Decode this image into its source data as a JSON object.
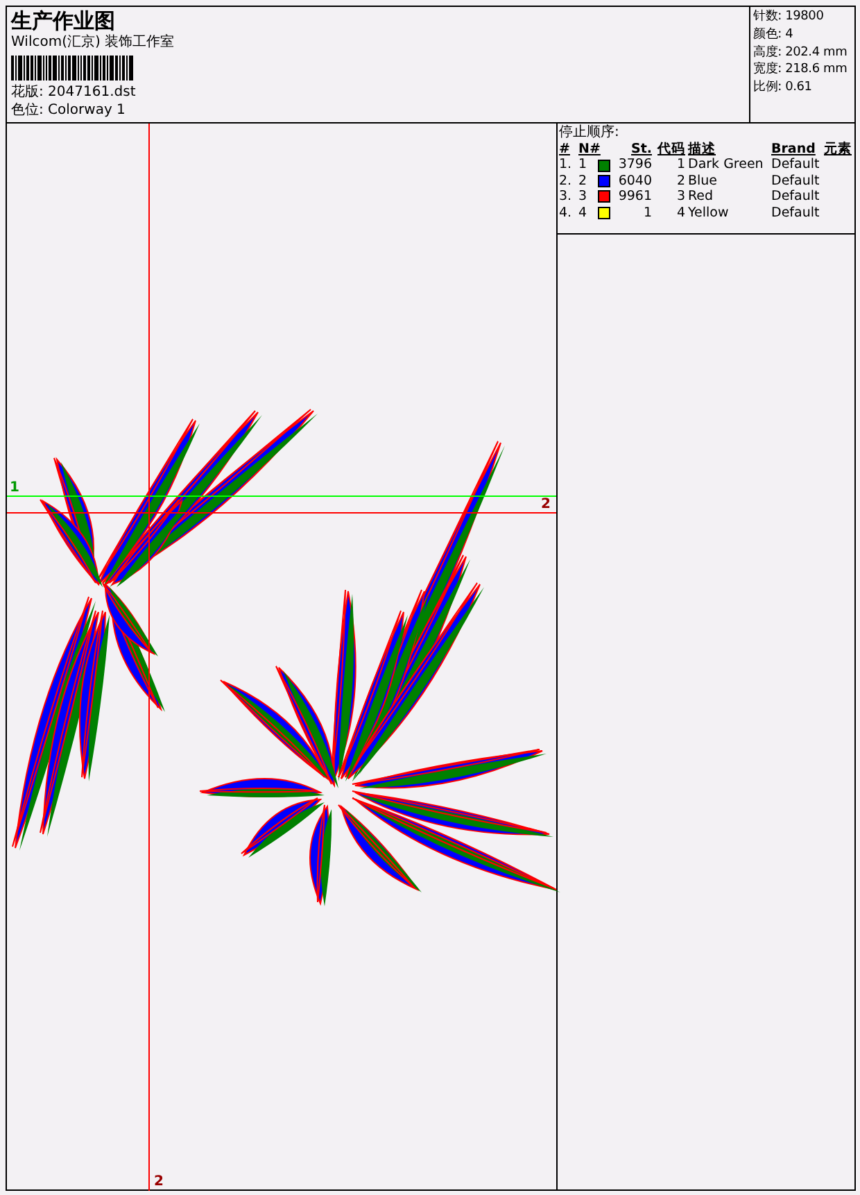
{
  "title": "生产作业图",
  "studio": "Wilcom(汇京) 装饰工作室",
  "design_file": {
    "label": "花版:",
    "value": "2047161.dst"
  },
  "colorway": {
    "label": "色位:",
    "value": "Colorway 1"
  },
  "stats": [
    {
      "label": "针数:",
      "value": "19800"
    },
    {
      "label": "颜色:",
      "value": "4"
    },
    {
      "label": "高度:",
      "value": "202.4 mm"
    },
    {
      "label": "宽度:",
      "value": "218.6 mm"
    },
    {
      "label": "比例:",
      "value": "0.61"
    }
  ],
  "stop_sequence": {
    "title": "停止顺序:",
    "columns": [
      "#",
      "N#",
      "St.",
      "代码",
      "描述",
      "Brand",
      "元素"
    ],
    "rows": [
      {
        "index": "1.",
        "number": "1",
        "color": "#008000",
        "stitches": "3796",
        "code": "1",
        "description": "Dark Green",
        "brand": "Default"
      },
      {
        "index": "2.",
        "number": "2",
        "color": "#0000ff",
        "stitches": "6040",
        "code": "2",
        "description": "Blue",
        "brand": "Default"
      },
      {
        "index": "3.",
        "number": "3",
        "color": "#ff0000",
        "stitches": "9961",
        "code": "3",
        "description": "Red",
        "brand": "Default"
      },
      {
        "index": "4.",
        "number": "4",
        "color": "#ffff00",
        "stitches": "1",
        "code": "4",
        "description": "Yellow",
        "brand": "Default"
      }
    ]
  },
  "canvas": {
    "guides": [
      {
        "kind": "horizontal",
        "label": "1",
        "color": "#00ff00"
      },
      {
        "kind": "horizontal",
        "label": "2",
        "color": "#ff0000"
      },
      {
        "kind": "vertical",
        "label": "2",
        "color": "#ff0000"
      }
    ]
  }
}
